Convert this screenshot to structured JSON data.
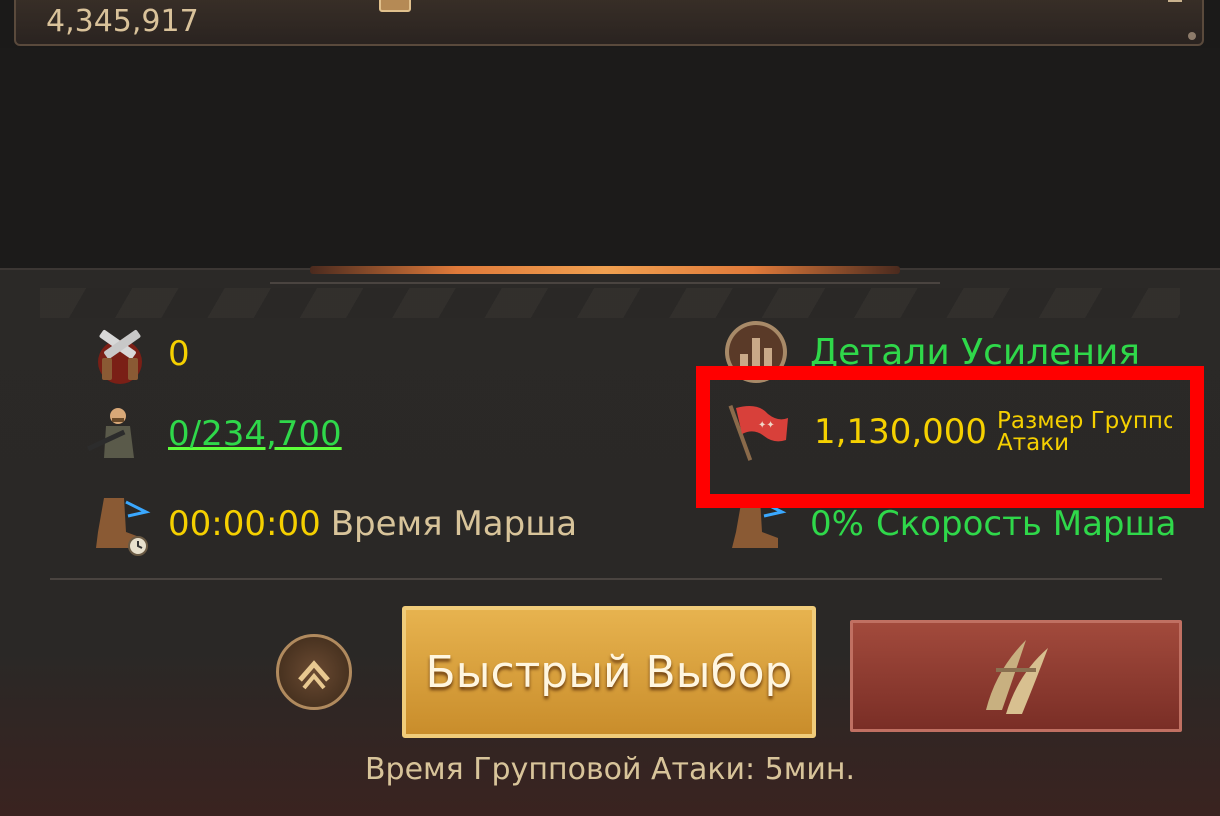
{
  "top_bar": {
    "power_value": "4,345,917"
  },
  "stats": {
    "weapons": {
      "value": "0",
      "icon": "crossed-pistols-icon"
    },
    "troops": {
      "value": "0/234,700",
      "icon": "soldier-icon"
    },
    "march_time": {
      "value": "00:00:00",
      "label": "Время Марша",
      "icon": "boot-clock-icon"
    },
    "boost_details": {
      "label": "Детали Усиления",
      "icon": "bar-chart-icon"
    },
    "rally_size": {
      "value": "1,130,000",
      "label": "Размер Группо\nАтаки",
      "icon": "red-flag-icon"
    },
    "march_speed": {
      "value": "0%",
      "label": "Скорость Марша",
      "icon": "winged-boot-icon"
    }
  },
  "buttons": {
    "quick_select": "Быстрый Выбор",
    "collapse_icon": "double-chevron-up-icon",
    "attack_icon": "claw-icon"
  },
  "footer": {
    "rally_time": "Время Групповой Атаки: 5мин."
  },
  "colors": {
    "value_yellow": "#f5d000",
    "value_green": "#2fd84a",
    "highlight_red": "#ff0000"
  }
}
